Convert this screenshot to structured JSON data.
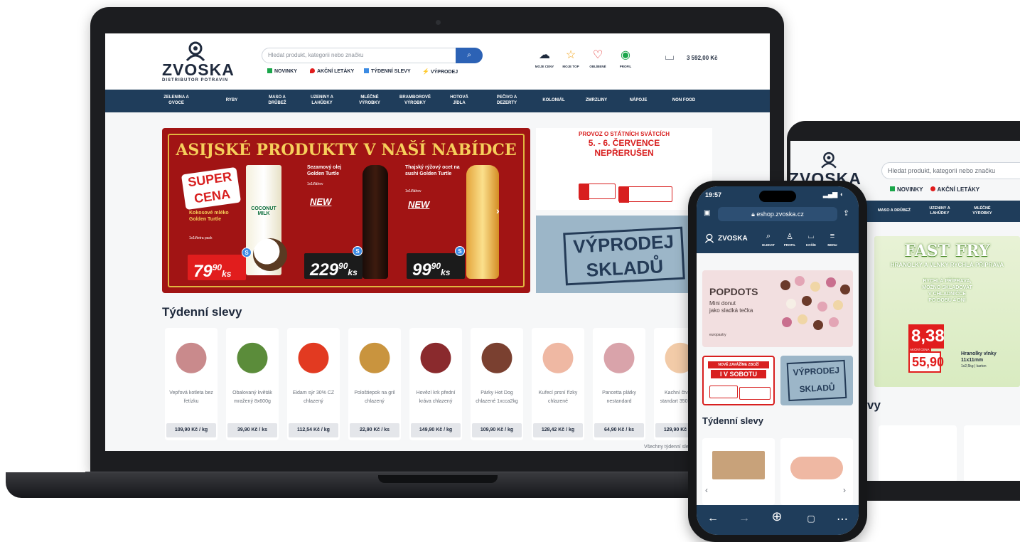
{
  "brand": {
    "name": "ZVOSKA",
    "tagline": "DISTRIBUTOR POTRAVIN"
  },
  "laptop": {
    "search": {
      "placeholder": "Hledat produkt, kategorii nebo značku",
      "button_icon": "search-icon"
    },
    "quick_links": [
      {
        "label": "NOVINKY",
        "icon": "flag-icon",
        "color": "#1aa64a"
      },
      {
        "label": "AKČNÍ LETÁKY",
        "icon": "fire-icon",
        "color": "#e11d1d"
      },
      {
        "label": "TÝDENNÍ SLEVY",
        "icon": "calendar-icon",
        "color": "#3c8be3"
      },
      {
        "label": "VÝPRODEJ",
        "icon": "bolt-icon",
        "color": "#f2a51d"
      }
    ],
    "header_icons": [
      {
        "label": "MOJE CENY",
        "icon": "piggy-bank-icon"
      },
      {
        "label": "MOJE TOP",
        "icon": "star-icon"
      },
      {
        "label": "OBLÍBENÉ",
        "icon": "heart-icon"
      },
      {
        "label": "PROFIL",
        "icon": "user-icon"
      }
    ],
    "cart_total": "3 592,00 Kč",
    "nav": [
      "ZELENINA A OVOCE",
      "RYBY",
      "MASO A DRŮBEŽ",
      "UZENINY A LAHŮDKY",
      "MLÉČNÉ VÝROBKY",
      "BRAMBOROVÉ VÝROBKY",
      "HOTOVÁ JÍDLA",
      "PEČIVO A DEZERTY",
      "KOLONIÁL",
      "ZMRZLINY",
      "NÁPOJE",
      "NON FOOD"
    ],
    "hero": {
      "title": "ASIJSKÉ PRODUKTY V NAŠÍ NABÍDCE",
      "super_label": "SUPER CENA",
      "products": [
        {
          "name": "Kokosové mléko Golden Turtle",
          "pack": "1x1l/tetra pack",
          "price_int": "79",
          "price_dec": "90",
          "unit": "ks",
          "carton_label": "COCONUT MILK"
        },
        {
          "name": "Sezamový olej Golden Turtle",
          "pack": "1x1l/láhev",
          "badge": "NEW",
          "price_int": "229",
          "price_dec": "90",
          "unit": "ks"
        },
        {
          "name": "Thajský rýžový ocet na sushi Golden Turtle",
          "pack": "1x1l/láhev",
          "badge": "NEW",
          "price_int": "99",
          "price_dec": "90",
          "unit": "ks"
        }
      ],
      "s_badge": "S"
    },
    "side_banner_1": {
      "line1": "PROVOZ O STÁTNÍCH SVÁTCÍCH",
      "line2": "5. - 6. ČERVENCE",
      "line3": "NEPŘERUŠEN"
    },
    "side_banner_2": {
      "line1": "VÝPRODEJ",
      "line2": "SKLADŮ"
    },
    "weekly_title": "Týdenní slevy",
    "products": [
      {
        "name": "Vepřová kotleta bez řetízku",
        "price": "109,90 Kč / kg",
        "color": "#c98a8c"
      },
      {
        "name": "Obalovaný květák mražený 8x600g",
        "price": "39,90 Kč / ks",
        "color": "#5b8c3a"
      },
      {
        "name": "Eidam sýr 30% CZ chlazený",
        "price": "112,54 Kč / kg",
        "color": "#e23a21"
      },
      {
        "name": "Pološtiepok na gril chlazený",
        "price": "22,90 Kč / ks",
        "color": "#c9943e"
      },
      {
        "name": "Hovězí krk přední kráva chlazený",
        "price": "149,90 Kč / kg",
        "color": "#8a2a2d"
      },
      {
        "name": "Párky Hot Dog chlazené 1xcca2kg",
        "price": "109,90 Kč / kg",
        "color": "#7a4030"
      },
      {
        "name": "Kuřecí prsní řízky chlazené",
        "price": "128,42 Kč / kg",
        "color": "#efb8a3"
      },
      {
        "name": "Pancetta plátky nestandard",
        "price": "64,90 Kč / ks",
        "color": "#d9a3aa"
      },
      {
        "name": "Kachní čtvrtky standart 350-400g",
        "price": "129,90 Kč / kg",
        "color": "#f2cba8"
      }
    ],
    "all_link": "Všechny týdenní slevy"
  },
  "tablet": {
    "search_placeholder": "Hledat produkt, kategorii nebo značku",
    "quick_links": [
      "NOVINKY",
      "AKČNÍ LETÁKY"
    ],
    "nav": [
      "MASO A DRŮBEŽ",
      "UZENINY A LAHŮDKY",
      "MLÉČNÉ VÝROBKY"
    ],
    "banner": {
      "title": "FAST FRY",
      "subtitle": "HRANOLKY A VLNKY RYCHLÁ PŘÍPRAVA",
      "text1": "RYCHLÁ PŘÍPRAVA,",
      "text2": "MOŽNO SKLADOVAT",
      "text3": "V CHLADNIČCE",
      "text4": "PO DOBU 4 DNÍ",
      "price_old": "8,38",
      "price_label": "AKČNÍ CENA",
      "price_new": "55,90",
      "product": "Hranolky vlnky",
      "size": "11x11mm",
      "pack": "1x2,5kg | karton"
    },
    "weekly_title_partial": "vy"
  },
  "phone": {
    "time": "19:57",
    "url": "eshop.zvoska.cz",
    "nav": [
      {
        "label": "HLEDAT",
        "icon": "search-icon"
      },
      {
        "label": "PROFIL",
        "icon": "user-icon"
      },
      {
        "label": "KOŠÍK",
        "icon": "cart-icon"
      },
      {
        "label": "MENU",
        "icon": "menu-icon"
      }
    ],
    "popdots": {
      "brand": "POPDOTS",
      "line1": "Mini donut",
      "line2": "jako sladká tečka",
      "maker": "europastry"
    },
    "banner1": {
      "line1": "NOVĚ ZAVÁŽÍME ZBOŽÍ",
      "line2": "I V SOBOTU"
    },
    "banner2": {
      "line1": "VÝPRODEJ",
      "line2": "SKLADŮ"
    },
    "weekly_title": "Týdenní slevy"
  }
}
